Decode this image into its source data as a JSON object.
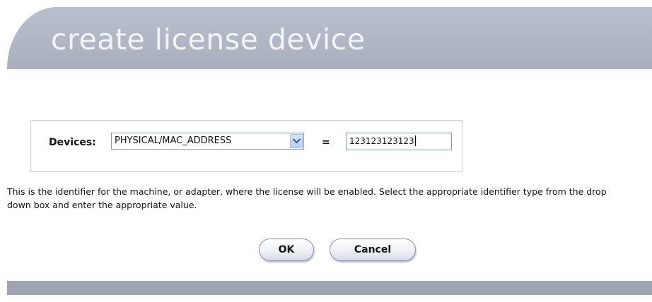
{
  "header": {
    "title": "create license device"
  },
  "form": {
    "devices_label": "Devices:",
    "device_type_selected": "PHYSICAL/MAC_ADDRESS",
    "equals_sign": "=",
    "device_value": "123123123123",
    "help_text": "This is the identifier for the machine, or adapter, where the license will be enabled. Select the appropriate identifier type from the drop down box and enter the appropriate value."
  },
  "buttons": {
    "ok_label": "OK",
    "cancel_label": "Cancel"
  },
  "icons": {
    "dropdown": "chevron-down-icon"
  },
  "colors": {
    "header_bg": "#aeb4c2",
    "header_text": "#f3f4f7",
    "footer_bar": "#9ea4b1",
    "dropdown_button": "#c6d6f7"
  }
}
